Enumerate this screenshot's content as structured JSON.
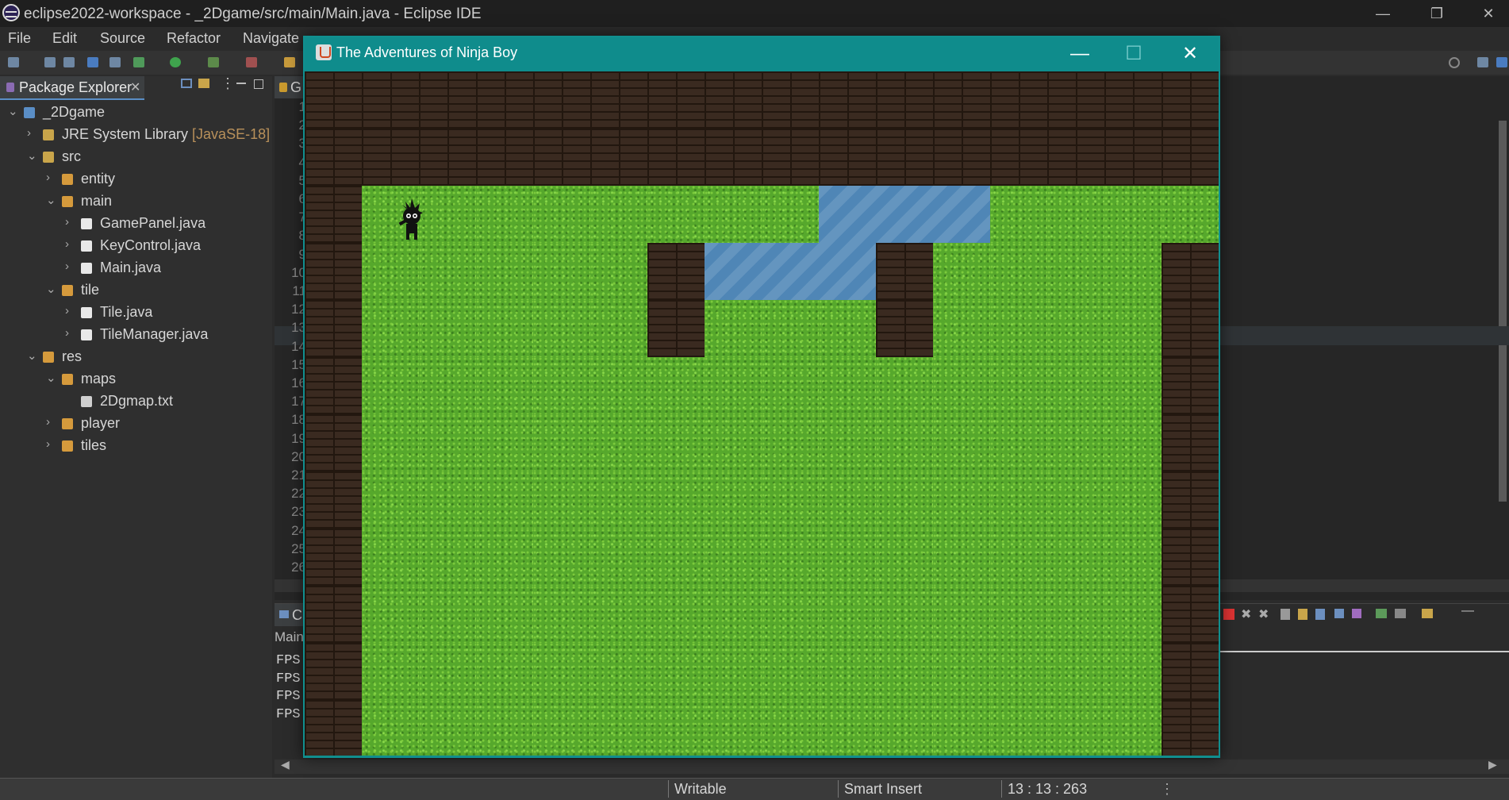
{
  "window": {
    "title": "eclipse2022-workspace - _2Dgame/src/main/Main.java - Eclipse IDE",
    "controls": [
      "—",
      "❐",
      "✕"
    ]
  },
  "menu": [
    "File",
    "Edit",
    "Source",
    "Refactor",
    "Navigate"
  ],
  "package_explorer": {
    "tab_label": "Package Explorer",
    "tree": [
      {
        "label": "_2Dgame",
        "depth": 0,
        "chevron": "⌄",
        "icon": "project-icon"
      },
      {
        "label": "JRE System Library",
        "decoration": "[JavaSE-18]",
        "depth": 1,
        "chevron": "›",
        "icon": "library-icon"
      },
      {
        "label": "src",
        "depth": 1,
        "chevron": "⌄",
        "icon": "source-folder-icon"
      },
      {
        "label": "entity",
        "depth": 2,
        "chevron": "›",
        "icon": "package-icon"
      },
      {
        "label": "main",
        "depth": 2,
        "chevron": "⌄",
        "icon": "package-icon"
      },
      {
        "label": "GamePanel.java",
        "depth": 3,
        "chevron": "›",
        "icon": "java-file-icon"
      },
      {
        "label": "KeyControl.java",
        "depth": 3,
        "chevron": "›",
        "icon": "java-file-icon"
      },
      {
        "label": "Main.java",
        "depth": 3,
        "chevron": "›",
        "icon": "java-file-icon"
      },
      {
        "label": "tile",
        "depth": 2,
        "chevron": "⌄",
        "icon": "package-icon"
      },
      {
        "label": "Tile.java",
        "depth": 3,
        "chevron": "›",
        "icon": "java-file-icon"
      },
      {
        "label": "TileManager.java",
        "depth": 3,
        "chevron": "›",
        "icon": "java-file-icon"
      },
      {
        "label": "res",
        "depth": 1,
        "chevron": "⌄",
        "icon": "folder-icon"
      },
      {
        "label": "maps",
        "depth": 2,
        "chevron": "⌄",
        "icon": "package-icon"
      },
      {
        "label": "2Dgmap.txt",
        "depth": 3,
        "chevron": "",
        "icon": "text-file-icon"
      },
      {
        "label": "player",
        "depth": 2,
        "chevron": "›",
        "icon": "package-icon"
      },
      {
        "label": "tiles",
        "depth": 2,
        "chevron": "›",
        "icon": "package-icon"
      }
    ]
  },
  "editor": {
    "tab_label": "G",
    "line_numbers": [
      "1",
      "2",
      "3",
      "4",
      "5",
      "6",
      "7",
      "8",
      "9",
      "10",
      "11",
      "12",
      "13",
      "14",
      "15",
      "16",
      "17",
      "18",
      "19",
      "20",
      "21",
      "22",
      "23",
      "24",
      "25",
      "26"
    ]
  },
  "console": {
    "tab_label": "C",
    "header": "Main",
    "lines": [
      "FPS",
      "FPS",
      "FPS",
      "FPS"
    ]
  },
  "status_bar": {
    "mode": "Writable",
    "insert": "Smart Insert",
    "position": "13 : 13 : 263"
  },
  "game_window": {
    "title": "The Adventures of Ninja Boy",
    "controls": [
      "—",
      "☐",
      "✕"
    ],
    "map": [
      "wwwwwwwwwwwwwwww",
      "wwwwwwwwwwwwwwww",
      "wggggggggaaaggggw",
      "wgggggwaaawggggw",
      "wgggggwgggwggggw",
      "wggggggggggggggw",
      "wggggggggggggggw",
      "wggggggggggggggw",
      "wggggggggggggggw",
      "wggggggggggggggw",
      "wggggggggggggggw",
      "wggggggggggggggw"
    ],
    "player_tile": {
      "col": 1.6,
      "row": 2.2
    }
  },
  "colors": {
    "game_title_bar": "#0f8c8c",
    "grass": "#56a82c",
    "brick": "#3a2a20",
    "water": "#4f86b6"
  }
}
